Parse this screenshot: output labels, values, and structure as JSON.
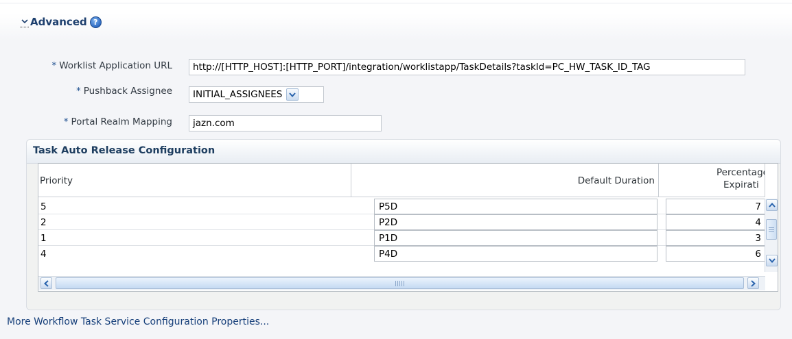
{
  "section": {
    "title": "Advanced",
    "help_glyph": "?",
    "expanded": true
  },
  "form": {
    "required_marker": "*",
    "worklist_url_label": "Worklist Application URL",
    "worklist_url_value": "http://[HTTP_HOST]:[HTTP_PORT]/integration/worklistapp/TaskDetails?taskId=PC_HW_TASK_ID_TAG",
    "pushback_label": "Pushback Assignee",
    "pushback_value": "INITIAL_ASSIGNEES",
    "realm_label": "Portal Realm Mapping",
    "realm_value": "jazn.com"
  },
  "auto_release": {
    "title": "Task Auto Release Configuration",
    "columns": {
      "priority": "Priority",
      "duration": "Default Duration",
      "percentage_line1": "Percentage",
      "percentage_line2": "Expirati"
    },
    "rows": [
      {
        "priority": "5",
        "duration": "P5D",
        "percentage": "7"
      },
      {
        "priority": "2",
        "duration": "P2D",
        "percentage": "4"
      },
      {
        "priority": "1",
        "duration": "P1D",
        "percentage": "3"
      },
      {
        "priority": "4",
        "duration": "P4D",
        "percentage": "6"
      }
    ]
  },
  "footer": {
    "more_link": "More Workflow Task Service Configuration Properties..."
  },
  "colors": {
    "section_title": "#1d3f6e",
    "label_text": "#323a43",
    "link_text": "#163f7a",
    "scroll_accent": "#c9daf0"
  }
}
